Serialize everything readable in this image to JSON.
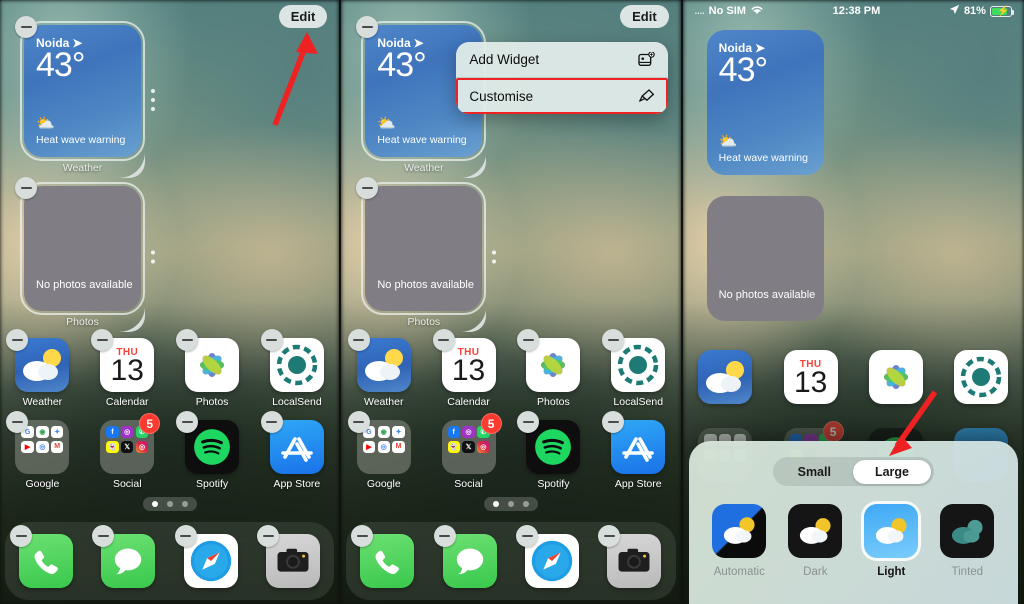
{
  "panels": [
    {
      "id": "panel-jiggle-mode",
      "edit_button": "Edit",
      "widgets": [
        {
          "name": "Weather",
          "city": "Noida",
          "temp": "43°",
          "warning": "Heat wave warning",
          "label": "Weather"
        },
        {
          "name": "Photos",
          "empty_text": "No photos available",
          "label": "Photos"
        }
      ],
      "apps_row1": [
        "Weather",
        "Calendar",
        "Photos",
        "LocalSend"
      ],
      "apps_row2": [
        "Google",
        "Social",
        "Spotify",
        "App Store"
      ],
      "social_badge": "5",
      "calendar": {
        "weekday": "THU",
        "day": "13"
      },
      "dock": [
        "Phone",
        "Messages",
        "Safari",
        "Camera"
      ],
      "page_dots": 3,
      "page_active": 1,
      "arrow": "points-to-edit-button"
    },
    {
      "id": "panel-context-menu",
      "edit_button": "Edit",
      "menu": {
        "items": [
          {
            "label": "Add Widget",
            "icon": "add-widget-icon",
            "highlighted": false
          },
          {
            "label": "Customise",
            "icon": "paintbrush-icon",
            "highlighted": true
          }
        ],
        "highlight_color": "#ee2222"
      },
      "widgets": [
        {
          "name": "Weather",
          "city": "Noida",
          "temp": "43°",
          "warning": "Heat wave warning",
          "label": "Weather"
        },
        {
          "name": "Photos",
          "empty_text": "No photos available",
          "label": "Photos"
        }
      ],
      "apps_row1": [
        "Weather",
        "Calendar",
        "Photos",
        "LocalSend"
      ],
      "apps_row2": [
        "Google",
        "Social",
        "Spotify",
        "App Store"
      ],
      "social_badge": "5",
      "calendar": {
        "weekday": "THU",
        "day": "13"
      },
      "dock": [
        "Phone",
        "Messages",
        "Safari",
        "Camera"
      ],
      "page_dots": 3,
      "page_active": 1
    },
    {
      "id": "panel-appearance-sheet",
      "statusbar": {
        "carrier": "No SIM",
        "signal_dots": "....",
        "wifi_icon": "wifi-icon",
        "time": "12:38 PM",
        "location_icon": "location-arrow-icon",
        "battery_percent": "81%",
        "battery_state": "charging"
      },
      "widgets": [
        {
          "name": "Weather",
          "city": "Noida",
          "temp": "43°",
          "warning": "Heat wave warning"
        },
        {
          "name": "Photos",
          "empty_text": "No photos available"
        }
      ],
      "apps_row1": [
        "Weather",
        "Calendar",
        "Photos",
        "LocalSend"
      ],
      "social_badge": "5",
      "calendar": {
        "weekday": "THU",
        "day": "13"
      },
      "sheet": {
        "size_segments": [
          {
            "label": "Small",
            "selected": false
          },
          {
            "label": "Large",
            "selected": true
          }
        ],
        "appearances": [
          {
            "label": "Automatic",
            "selected": false,
            "thumb": "weather-icon-auto"
          },
          {
            "label": "Dark",
            "selected": false,
            "thumb": "weather-icon-dark"
          },
          {
            "label": "Light",
            "selected": true,
            "thumb": "weather-icon-light"
          },
          {
            "label": "Tinted",
            "selected": false,
            "thumb": "weather-icon-tinted"
          }
        ]
      },
      "arrow": "points-to-large-segment"
    }
  ],
  "colors": {
    "accent_red": "#ee2222",
    "badge_red": "#fb3b30",
    "widget_blue": "#4f86c8",
    "battery_green": "#3ddc5c"
  }
}
